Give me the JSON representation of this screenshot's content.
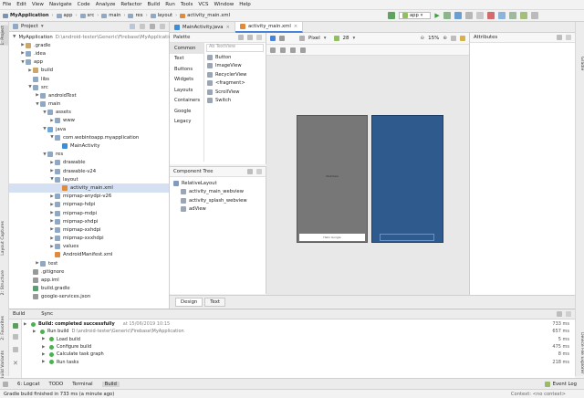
{
  "menu": [
    "File",
    "Edit",
    "View",
    "Navigate",
    "Code",
    "Analyze",
    "Refactor",
    "Build",
    "Run",
    "Tools",
    "VCS",
    "Window",
    "Help"
  ],
  "breadcrumb": [
    "MyApplication",
    "app",
    "src",
    "main",
    "res",
    "layout",
    "activity_main.xml"
  ],
  "toolbar": {
    "run_config": "app"
  },
  "project_panel": {
    "title": "Project",
    "tree": [
      {
        "label": "MyApplication",
        "suffix": "D:\\android-tester\\Generic\\Firebase\\MyApplication",
        "indent": 0,
        "arrow": "▼",
        "color": "#7a93b3"
      },
      {
        "label": ".gradle",
        "indent": 1,
        "arrow": "▶",
        "color": "#c9a86a"
      },
      {
        "label": ".idea",
        "indent": 1,
        "arrow": "▶",
        "color": "#8fa8c4"
      },
      {
        "label": "app",
        "indent": 1,
        "arrow": "▼",
        "color": "#8fa8c4"
      },
      {
        "label": "build",
        "indent": 2,
        "arrow": "▶",
        "color": "#c9a86a"
      },
      {
        "label": "libs",
        "indent": 2,
        "arrow": "",
        "color": "#8fa8c4"
      },
      {
        "label": "src",
        "indent": 2,
        "arrow": "▼",
        "color": "#8fa8c4"
      },
      {
        "label": "androidTest",
        "indent": 3,
        "arrow": "▶",
        "color": "#8fa8c4"
      },
      {
        "label": "main",
        "indent": 3,
        "arrow": "▼",
        "color": "#8fa8c4"
      },
      {
        "label": "assets",
        "indent": 4,
        "arrow": "▼",
        "color": "#8fa8c4"
      },
      {
        "label": "www",
        "indent": 5,
        "arrow": "▶",
        "color": "#8fa8c4"
      },
      {
        "label": "java",
        "indent": 4,
        "arrow": "▼",
        "color": "#6ea7d8"
      },
      {
        "label": "com.webintoapp.myapplication",
        "indent": 5,
        "arrow": "▼",
        "color": "#8fa8c4"
      },
      {
        "label": "MainActivity",
        "indent": 6,
        "arrow": "",
        "color": "#3d8ed6"
      },
      {
        "label": "res",
        "indent": 4,
        "arrow": "▼",
        "color": "#8fa8c4"
      },
      {
        "label": "drawable",
        "indent": 5,
        "arrow": "▶",
        "color": "#8fa8c4"
      },
      {
        "label": "drawable-v24",
        "indent": 5,
        "arrow": "▶",
        "color": "#8fa8c4"
      },
      {
        "label": "layout",
        "indent": 5,
        "arrow": "▼",
        "color": "#8fa8c4"
      },
      {
        "label": "activity_main.xml",
        "indent": 6,
        "arrow": "",
        "color": "#e08a3a",
        "selected": true
      },
      {
        "label": "mipmap-anydpi-v26",
        "indent": 5,
        "arrow": "▶",
        "color": "#8fa8c4"
      },
      {
        "label": "mipmap-hdpi",
        "indent": 5,
        "arrow": "▶",
        "color": "#8fa8c4"
      },
      {
        "label": "mipmap-mdpi",
        "indent": 5,
        "arrow": "▶",
        "color": "#8fa8c4"
      },
      {
        "label": "mipmap-xhdpi",
        "indent": 5,
        "arrow": "▶",
        "color": "#8fa8c4"
      },
      {
        "label": "mipmap-xxhdpi",
        "indent": 5,
        "arrow": "▶",
        "color": "#8fa8c4"
      },
      {
        "label": "mipmap-xxxhdpi",
        "indent": 5,
        "arrow": "▶",
        "color": "#8fa8c4"
      },
      {
        "label": "values",
        "indent": 5,
        "arrow": "▶",
        "color": "#8fa8c4"
      },
      {
        "label": "AndroidManifest.xml",
        "indent": 5,
        "arrow": "",
        "color": "#e08a3a"
      },
      {
        "label": "test",
        "indent": 3,
        "arrow": "▶",
        "color": "#8fa8c4"
      },
      {
        "label": ".gitignore",
        "indent": 2,
        "arrow": "",
        "color": "#999999"
      },
      {
        "label": "app.iml",
        "indent": 2,
        "arrow": "",
        "color": "#999999"
      },
      {
        "label": "build.gradle",
        "indent": 2,
        "arrow": "",
        "color": "#5a9e6f"
      },
      {
        "label": "google-services.json",
        "indent": 2,
        "arrow": "",
        "color": "#999999"
      }
    ]
  },
  "editor_tabs": [
    {
      "label": "MainActivity.java",
      "color": "#3d8ed6"
    },
    {
      "label": "activity_main.xml",
      "color": "#e08a3a",
      "active": true
    }
  ],
  "palette": {
    "title": "Palette",
    "search_placeholder": "Ab TextView",
    "categories": [
      "Common",
      "Text",
      "Buttons",
      "Widgets",
      "Layouts",
      "Containers",
      "Google",
      "Legacy"
    ],
    "items": [
      "Button",
      "ImageView",
      "RecyclerView",
      "<fragment>",
      "ScrollView",
      "Switch"
    ]
  },
  "component_tree": {
    "title": "Component Tree",
    "items": [
      {
        "label": "RelativeLayout",
        "indent": 0
      },
      {
        "label": "activity_main_webview",
        "indent": 1
      },
      {
        "label": "activity_splash_webview",
        "indent": 1
      },
      {
        "label": "adView",
        "indent": 1
      }
    ]
  },
  "design_toolbar": {
    "device": "Pixel",
    "api": "28",
    "zoom": "15%"
  },
  "phone1_texts": {
    "center": "WebView",
    "bottom": "Hello Google"
  },
  "attributes": {
    "title": "Attributes"
  },
  "design_tabs": [
    "Design",
    "Text"
  ],
  "build": {
    "tab_build": "Build",
    "tab_sync": "Sync",
    "rows": [
      {
        "label": "Build: completed successfully",
        "time": "at 15/06/2019 10:15",
        "dur": "733 ms",
        "indent": 0,
        "bold": true
      },
      {
        "label": "Run build",
        "suffix": "D:\\android-tester\\Generic\\Firebase\\MyApplication",
        "dur": "657 ms",
        "indent": 1
      },
      {
        "label": "Load build",
        "dur": "5 ms",
        "indent": 2
      },
      {
        "label": "Configure build",
        "dur": "475 ms",
        "indent": 2
      },
      {
        "label": "Calculate task graph",
        "dur": "8 ms",
        "indent": 2
      },
      {
        "label": "Run tasks",
        "dur": "218 ms",
        "indent": 2
      }
    ]
  },
  "bottom_tabs": [
    "6: Logcat",
    "TODO",
    "Terminal",
    "Build"
  ],
  "event_log": "Event Log",
  "status": {
    "message": "Gradle build finished in 733 ms (a minute ago)",
    "context": "Context: <no context>"
  },
  "left_tabs": [
    "1: Project",
    "Layout Captures",
    "2: Structure",
    "2: Favorites",
    "Build Variants"
  ],
  "right_tabs": [
    "Gradle",
    "Device File Explorer"
  ]
}
